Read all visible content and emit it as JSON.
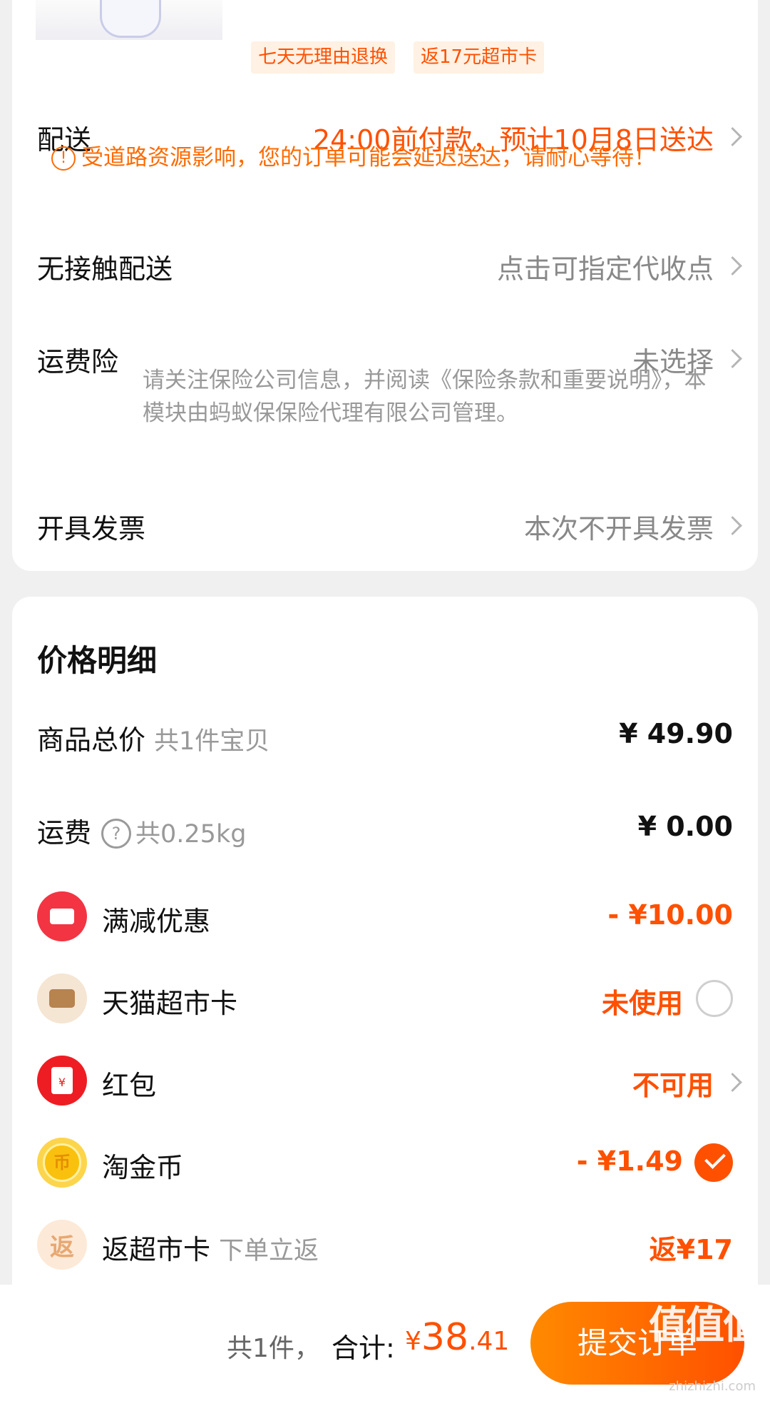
{
  "product": {
    "tags": [
      "七天无理由退换",
      "返17元超市卡"
    ]
  },
  "delivery": {
    "label": "配送",
    "value": "24:00前付款，预计10月8日送达",
    "notice": "受道路资源影响，您的订单可能会延迟送达，请耐心等待！"
  },
  "contactless": {
    "label": "无接触配送",
    "value": "点击可指定代收点"
  },
  "insurance": {
    "label": "运费险",
    "value": "未选择",
    "note": "请关注保险公司信息，并阅读《保险条款和重要说明》，本模块由蚂蚁保保险代理有限公司管理。"
  },
  "invoice": {
    "label": "开具发票",
    "value": "本次不开具发票"
  },
  "price_detail": {
    "title": "价格明细",
    "goods_total": {
      "label": "商品总价",
      "sub": "共1件宝贝",
      "amount": "¥ 49.90"
    },
    "shipping": {
      "label": "运费",
      "sub": "共0.25kg",
      "amount": "¥ 0.00"
    },
    "full_discount": {
      "label": "满减优惠",
      "amount": "- ¥10.00"
    },
    "tmall_card": {
      "label": "天猫超市卡",
      "status": "未使用",
      "selected": false
    },
    "red_packet": {
      "label": "红包",
      "status": "不可用"
    },
    "taojin_coin": {
      "label": "淘金币",
      "amount": "- ¥1.49",
      "selected": true
    },
    "rebate_card": {
      "label": "返超市卡",
      "sub": "下单立返",
      "amount": "返¥17"
    }
  },
  "footer": {
    "count": "共1件，",
    "total_label": "合计:",
    "currency": "¥",
    "total_int": "38",
    "total_dec": ".41",
    "submit_label": "提交订单"
  },
  "watermark": {
    "logo": "值值值",
    "site": "zhizhizhi.com"
  },
  "colors": {
    "accent": "#ff5000",
    "muted": "#999999",
    "background": "#f0f0f0"
  }
}
